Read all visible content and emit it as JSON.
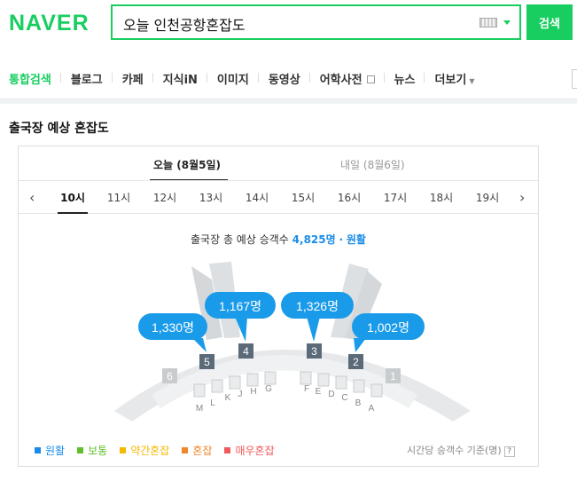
{
  "header": {
    "logo": "NAVER",
    "search_value": "오늘 인천공항혼잡도",
    "search_button": "검색"
  },
  "nav": {
    "items": [
      "통합검색",
      "블로그",
      "카페",
      "지식iN",
      "이미지",
      "동영상",
      "어학사전",
      "뉴스",
      "더보기"
    ]
  },
  "section_title": "출국장 예상 혼잡도",
  "days": {
    "today": "오늘 (8월5일)",
    "tomorrow": "내일 (8월6일)"
  },
  "hours": [
    "10시",
    "11시",
    "12시",
    "13시",
    "14시",
    "15시",
    "16시",
    "17시",
    "18시",
    "19시"
  ],
  "active_hour": "10시",
  "summary": {
    "prefix": "출국장 총 예상 승객수",
    "count": "4,825명",
    "separator": "·",
    "status": "원활"
  },
  "gates": {
    "labels": [
      "6",
      "5",
      "4",
      "3",
      "2",
      "1"
    ],
    "bubbles": [
      {
        "gate": "5",
        "text": "1,330명"
      },
      {
        "gate": "4",
        "text": "1,167명"
      },
      {
        "gate": "3",
        "text": "1,326명"
      },
      {
        "gate": "2",
        "text": "1,002명"
      }
    ],
    "counter_letters": [
      "M",
      "L",
      "K",
      "J",
      "H",
      "G",
      "F",
      "E",
      "D",
      "C",
      "B",
      "A"
    ]
  },
  "legend": {
    "items": [
      {
        "label": "원활",
        "color": "#1a8ce8"
      },
      {
        "label": "보통",
        "color": "#5dbf2a"
      },
      {
        "label": "약간혼잡",
        "color": "#f5b800"
      },
      {
        "label": "혼잡",
        "color": "#f0862a"
      },
      {
        "label": "매우혼잡",
        "color": "#f05a5a"
      }
    ],
    "note": "시간당 승객수 기준(명)",
    "help": "?"
  },
  "colors": {
    "brand": "#19ce60",
    "accent": "#1a8ce8",
    "bubble": "#1a9bea",
    "gate_open": "#5a6a78",
    "gate_closed": "#c9cccf",
    "terminal": "#e6e8ea"
  }
}
